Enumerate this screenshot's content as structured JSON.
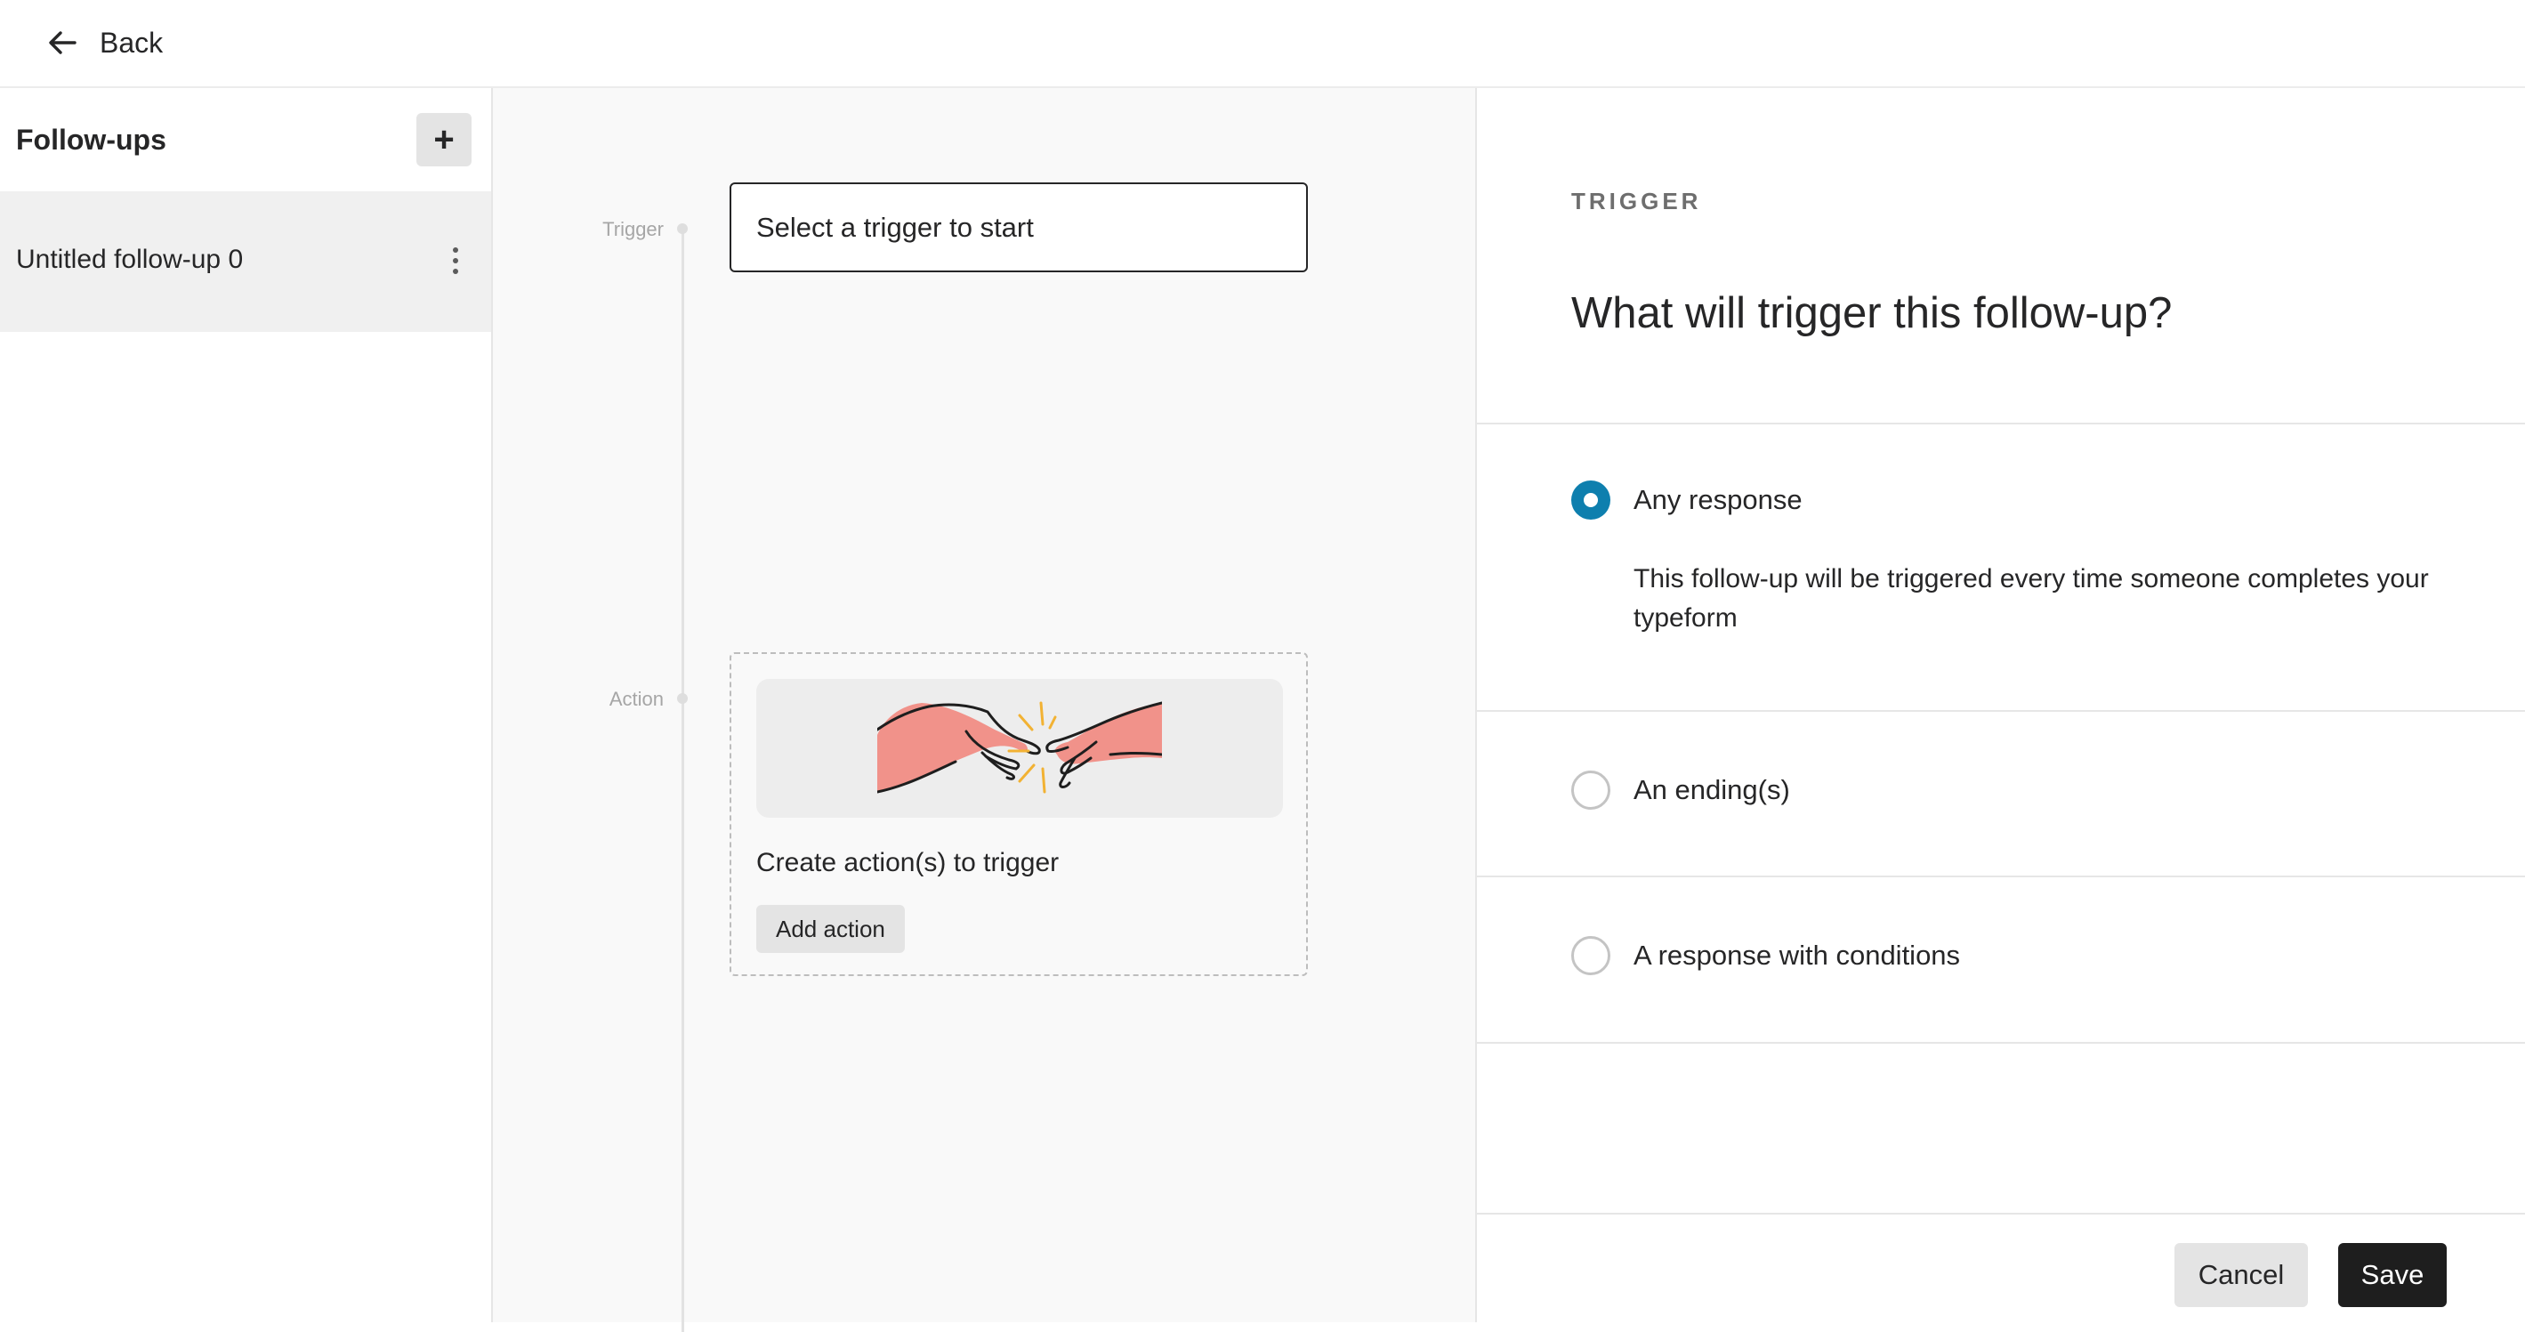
{
  "header": {
    "back_label": "Back",
    "back_icon": "arrow-left-icon"
  },
  "sidebar": {
    "title": "Follow-ups",
    "add_icon": "plus-icon",
    "items": [
      {
        "label": "Untitled follow-up 0",
        "selected": true,
        "menu_icon": "kebab-icon"
      }
    ]
  },
  "canvas": {
    "trigger_step_label": "Trigger",
    "trigger_placeholder": "Select a trigger to start",
    "action_step_label": "Action",
    "action_illustration": "hands-reaching-illustration",
    "action_text": "Create action(s) to trigger",
    "add_action_label": "Add action"
  },
  "panel": {
    "eyebrow": "TRIGGER",
    "title": "What will trigger this follow-up?",
    "options": [
      {
        "label": "Any response",
        "selected": true,
        "description": "This follow-up will be triggered every time someone completes your typeform"
      },
      {
        "label": "An ending(s)",
        "selected": false
      },
      {
        "label": "A response with conditions",
        "selected": false
      }
    ],
    "cancel_label": "Cancel",
    "save_label": "Save"
  },
  "colors": {
    "accent": "#0e7fae",
    "save_bg": "#1e1e1e",
    "secondary_btn_bg": "#e4e4e4",
    "selected_item_bg": "#f0f0f0",
    "canvas_bg": "#f9f9f9",
    "hand_fill": "#f1928a"
  }
}
